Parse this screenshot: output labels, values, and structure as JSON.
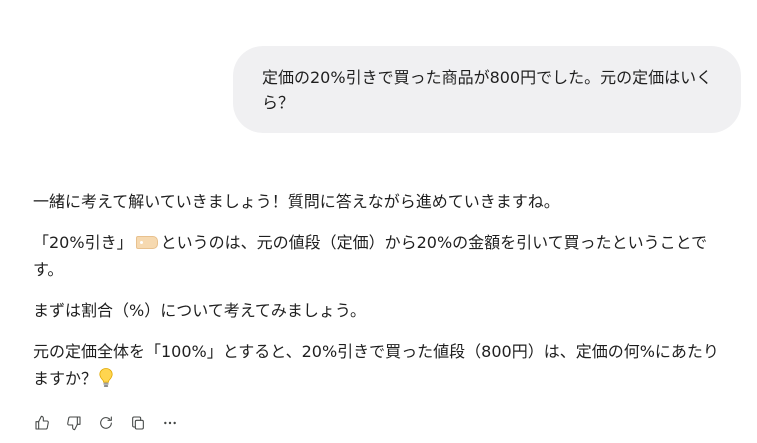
{
  "user_message": {
    "text": "定価の20%引きで買った商品が800円でした。元の定価はいくら？"
  },
  "assistant_message": {
    "p1": "一緒に考えて解いていきましょう！質問に答えながら進めていきますね。",
    "p2_before": "「20%引き」",
    "p2_after": "というのは、元の値段（定価）から20%の金額を引いて買ったということです。",
    "p3": "まずは割合（%）について考えてみましょう。",
    "p4": "元の定価全体を「100%」とすると、20%引きで買った値段（800円）は、定価の何%にあたりますか？"
  },
  "icons": {
    "tag": "label-tag-emoji",
    "bulb": "light-bulb-emoji",
    "actions": [
      "thumbs-up-icon",
      "thumbs-down-icon",
      "regenerate-icon",
      "copy-icon",
      "more-options-icon"
    ]
  }
}
